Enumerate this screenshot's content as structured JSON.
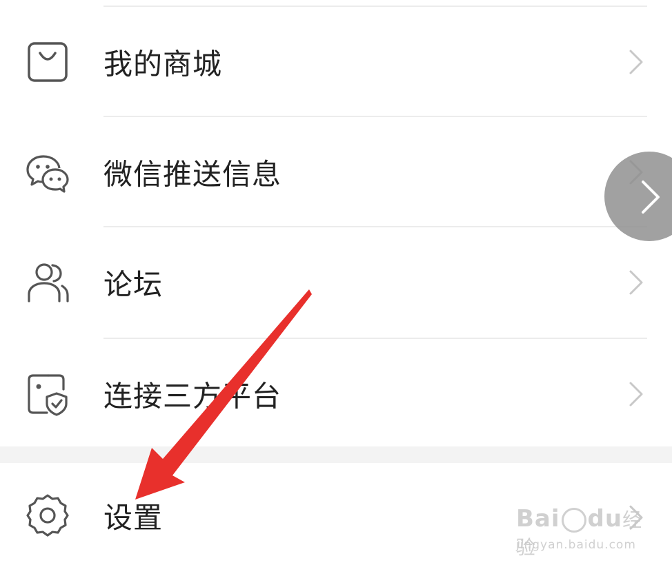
{
  "menu": {
    "items": [
      {
        "label": "我的商城",
        "icon": "shopping-bag-icon"
      },
      {
        "label": "微信推送信息",
        "icon": "wechat-icon"
      },
      {
        "label": "论坛",
        "icon": "users-icon"
      },
      {
        "label": "连接三方平台",
        "icon": "shield-link-icon"
      },
      {
        "label": "设置",
        "icon": "gear-icon"
      }
    ]
  },
  "watermark": {
    "brand": "Bai",
    "brand_mid": "du",
    "brand_cn": "经验",
    "url": "jingyan.baidu.com"
  },
  "colors": {
    "text": "#222222",
    "icon": "#555555",
    "chevron": "#c8c8c8",
    "arrow": "#e8302c"
  }
}
